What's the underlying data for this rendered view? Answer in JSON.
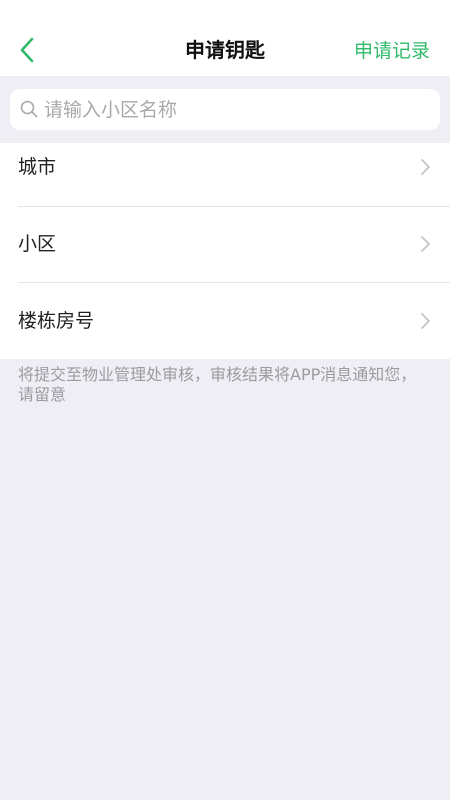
{
  "navbar": {
    "back_icon": "chevron-left-icon",
    "title": "申请钥匙",
    "right_action": "申请记录",
    "accent_color": "#2fba6a"
  },
  "search": {
    "icon": "search-icon",
    "placeholder": "请输入小区名称",
    "value": ""
  },
  "form": {
    "rows": [
      {
        "label": "城市",
        "icon": "chevron-right-icon"
      },
      {
        "label": "小区",
        "icon": "chevron-right-icon"
      },
      {
        "label": "楼栋房号",
        "icon": "chevron-right-icon"
      }
    ]
  },
  "notice": "将提交至物业管理处审核，审核结果将APP消息通知您，请留意"
}
